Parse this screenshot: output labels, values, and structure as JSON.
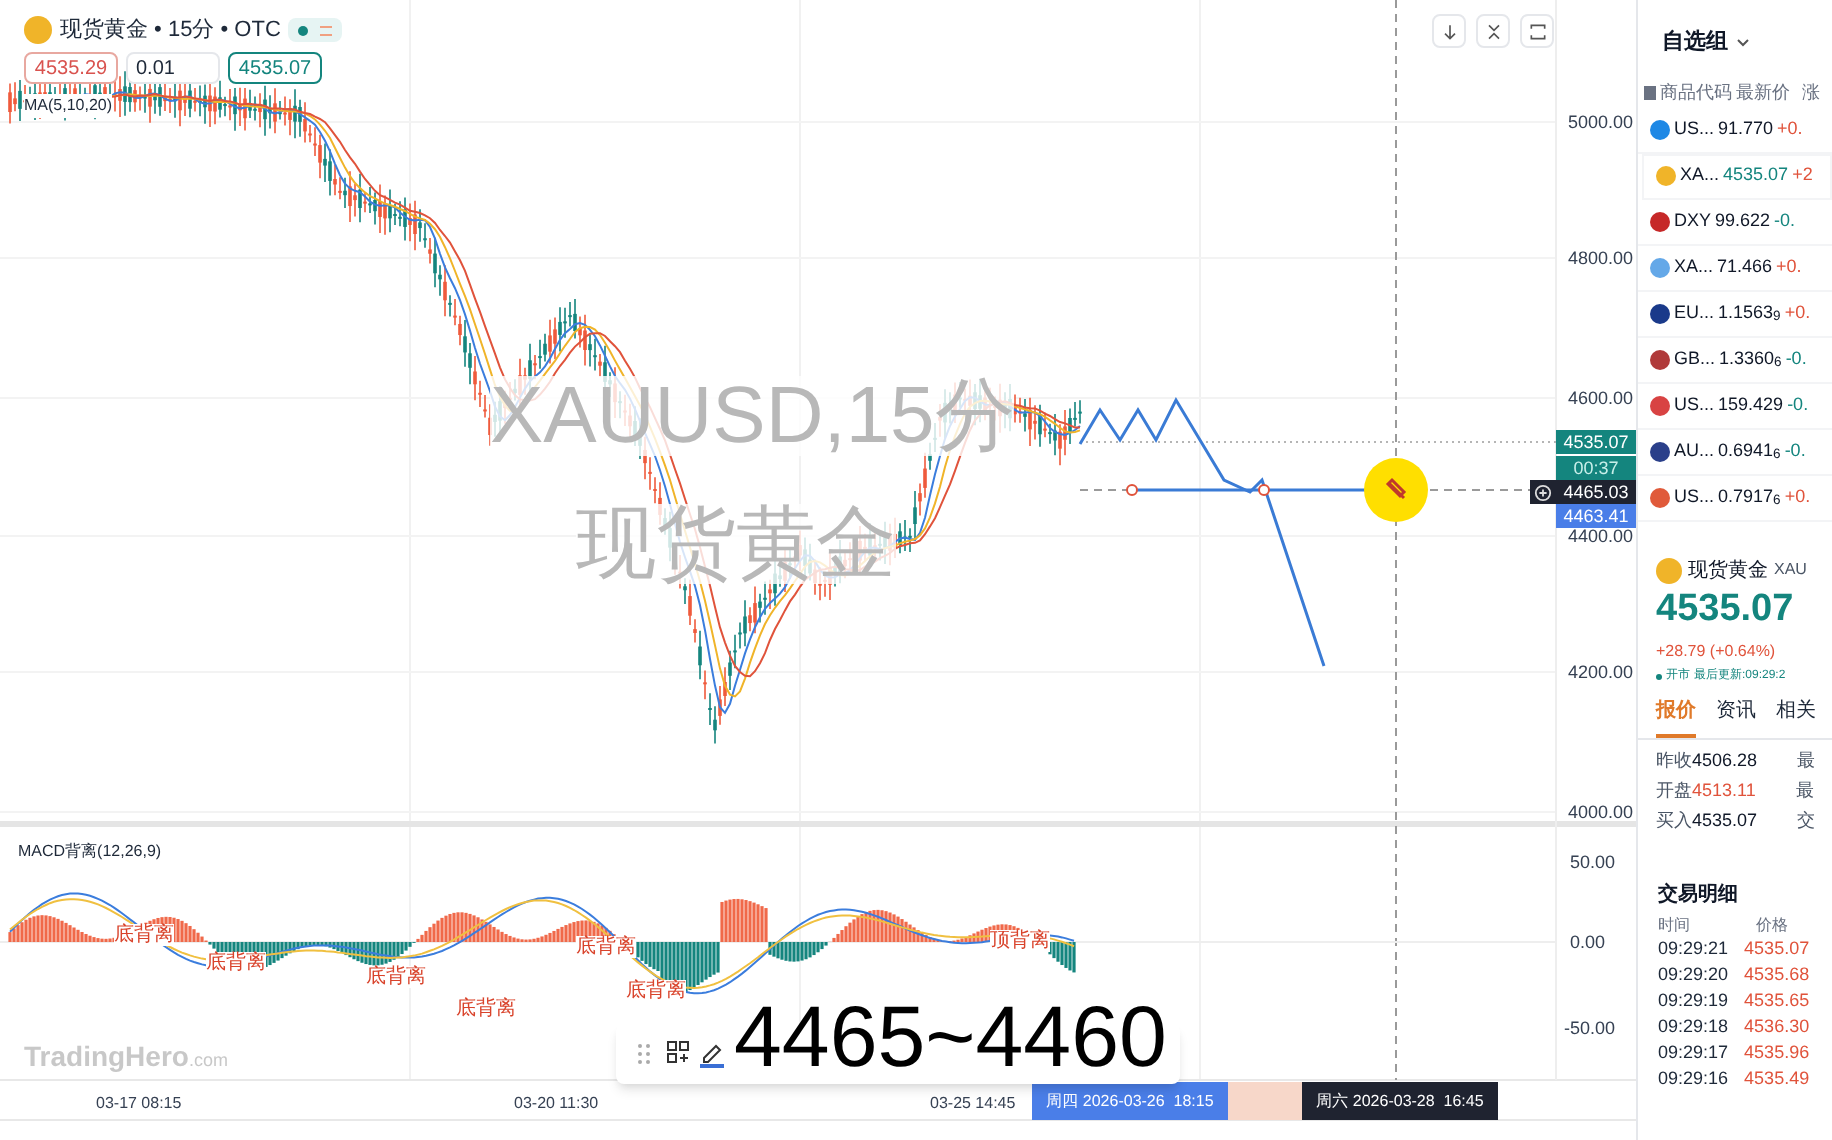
{
  "symbol_header": {
    "title": "现货黄金 • 15分 • OTC",
    "toggle_on": true,
    "sell": "4535.29",
    "spread": "0.01",
    "buy": "4535.07"
  },
  "indicator_label": "MA(5,10,20)",
  "chart_watermark": [
    "XAUUSD,15分",
    "现货黄金"
  ],
  "price_axis": [
    "5000.00",
    "4800.00",
    "4600.00",
    "4400.00",
    "4200.00",
    "4000.00"
  ],
  "price_tags": [
    {
      "kind": "last",
      "text": "4535.07"
    },
    {
      "kind": "timer",
      "text": "00:37"
    },
    {
      "kind": "crosshair",
      "text": "4465.03"
    },
    {
      "kind": "line",
      "text": "4463.41"
    }
  ],
  "macd": {
    "label": "MACD背离(12,26,9)",
    "axis": [
      "50.00",
      "0.00",
      "-50.00"
    ],
    "annotations": [
      "底背离",
      "底背离",
      "底背离",
      "底背离",
      "底背离",
      "底背离",
      "顶背离"
    ]
  },
  "brand": {
    "name": "TradingHero",
    "suffix": ".com"
  },
  "time_axis": [
    "03-17 08:15",
    "03-20 11:30",
    "03-25 14:45"
  ],
  "crosshair_time": "周四 2026-03-26  18:15",
  "projection_time": "周六 2026-03-28  16:45",
  "caption": "4465~4460",
  "sidebar": {
    "title": "自选组",
    "columns": [
      "商品代码",
      "最新价",
      "涨"
    ],
    "rows": [
      {
        "symbol": "US...",
        "price": "91.770",
        "change": "+0.",
        "up": true,
        "selected": false
      },
      {
        "symbol": "XA...",
        "price": "4535.07",
        "change": "+2",
        "up": true,
        "selected": true
      },
      {
        "symbol": "DXY",
        "price": "99.622",
        "change": "-0.",
        "up": false,
        "selected": false
      },
      {
        "symbol": "XA...",
        "price": "71.466",
        "change": "+0.",
        "up": true,
        "selected": false
      },
      {
        "symbol": "EU...",
        "price": "1.1563$_{9}$",
        "change": "+0.",
        "up": true,
        "selected": false
      },
      {
        "symbol": "GB...",
        "price": "1.3360$_{6}$",
        "change": "-0.",
        "up": false,
        "selected": false
      },
      {
        "symbol": "US...",
        "price": "159.429",
        "change": "-0.",
        "up": false,
        "selected": false
      },
      {
        "symbol": "AU...",
        "price": "0.6941$_{6}$",
        "change": "-0.",
        "up": false,
        "selected": false
      },
      {
        "symbol": "US...",
        "price": "0.7917$_{6}$",
        "change": "+0.",
        "up": true,
        "selected": false
      }
    ]
  },
  "detail": {
    "name": "现货黄金",
    "code": "XAU",
    "price": "4535.07",
    "change": "+28.79 (+0.64%)",
    "status": "开市",
    "updated": "最后更新:09:29:2",
    "tabs": [
      {
        "label": "报价",
        "selected": true
      },
      {
        "label": "资讯",
        "selected": false
      },
      {
        "label": "相关",
        "selected": false
      }
    ],
    "stats": [
      {
        "label": "昨收",
        "value": "4506.28",
        "up": false,
        "next": "最"
      },
      {
        "label": "开盘",
        "value": "4513.11",
        "up": true,
        "next": "最"
      },
      {
        "label": "买入",
        "value": "4535.07",
        "up": false,
        "next": "交"
      }
    ],
    "trades_title": "交易明细",
    "trade_columns": [
      "时间",
      "价格"
    ],
    "trades": [
      {
        "time": "09:29:21",
        "price": "4535.07"
      },
      {
        "time": "09:29:20",
        "price": "4535.68"
      },
      {
        "time": "09:29:19",
        "price": "4535.65"
      },
      {
        "time": "09:29:18",
        "price": "4536.30"
      },
      {
        "time": "09:29:17",
        "price": "4535.96"
      },
      {
        "time": "09:29:16",
        "price": "4535.49"
      }
    ]
  }
}
